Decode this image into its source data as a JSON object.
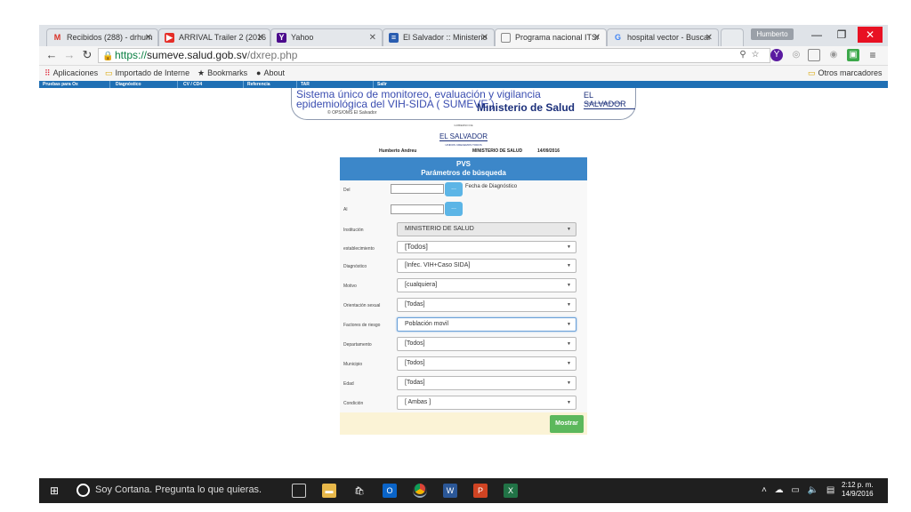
{
  "browser": {
    "tabs": [
      {
        "title": "Recibidos (288) - drhum",
        "favicon": "gmail-icon",
        "favicon_text": "M",
        "favicon_color": "#d93025"
      },
      {
        "title": "ARRIVAL Trailer 2 (2016",
        "favicon": "youtube-icon",
        "favicon_text": "▶",
        "favicon_color": "#e52d27"
      },
      {
        "title": "Yahoo",
        "favicon": "yahoo-icon",
        "favicon_text": "Y",
        "favicon_color": "#4b0a8c"
      },
      {
        "title": "El Salvador :: Ministerio",
        "favicon": "flag-icon",
        "favicon_text": "≡",
        "favicon_color": "#2a5db0"
      },
      {
        "title": "Programa nacional ITS/",
        "favicon": "page-icon",
        "favicon_text": "▯",
        "favicon_color": "#888888"
      },
      {
        "title": "hospital vector - Buscar",
        "favicon": "google-icon",
        "favicon_text": "G",
        "favicon_color": "#4285f4"
      }
    ],
    "profile_name": "Humberto",
    "url_scheme": "https://",
    "url_host": "sumeve.salud.gob.sv",
    "url_path": "/dxrep.php",
    "bookmarks": {
      "apps": "Aplicaciones",
      "imported": "Importado de Interne",
      "bookmarks": "Bookmarks",
      "about": "About",
      "other": "Otros marcadores"
    },
    "window_controls": {
      "minimize": "—",
      "maximize": "❐",
      "close": "✕"
    }
  },
  "page": {
    "menu": [
      "Pruebas para Ox",
      "Diagnóstico",
      "CV / CD4",
      "Referencia",
      "TAR",
      "Salir"
    ],
    "banner": {
      "line1": "Sistema único de monitoreo, evaluación y vigilancia",
      "line2": "epidemiológica del VIH-SIDA ( SUMEVE )",
      "credit": "© OPS/OMS El Salvador",
      "ministry": "Ministerio de Salud",
      "country": "EL SALVADOR",
      "country_sub": "UNIDOS CRECEMOS TODOS"
    },
    "logo": {
      "top": "GOBIERNO DE",
      "main": "EL SALVADOR",
      "sub": "UNIDOS CRECEMOS TODOS"
    },
    "user": {
      "name": "Humberto Andreu",
      "institution": "MINISTERIO DE SALUD",
      "date": "14/09/2016"
    },
    "panel": {
      "title": "PVS",
      "subtitle": "Parámetros de búsqueda",
      "del_label": "Del",
      "al_label": "Al",
      "date_button": "...",
      "fecha_label": "Fecha de Diagnóstico",
      "fields": [
        {
          "label": "Institución",
          "value": "MINISTERIO DE SALUD"
        },
        {
          "label": "establecimiento",
          "value": "[Todos]"
        },
        {
          "label": "Diagnóstico",
          "value": "[Infec. VIH+Caso SIDA]"
        },
        {
          "label": "Motivo",
          "value": "[cualquiera]"
        },
        {
          "label": "Orientación sexual",
          "value": "[Todas]"
        },
        {
          "label": "Factores de riesgo",
          "value": "Población movil"
        },
        {
          "label": "Departamento",
          "value": "[Todos]"
        },
        {
          "label": "Municipio",
          "value": "[Todos]"
        },
        {
          "label": "Edad",
          "value": "[Todas]"
        },
        {
          "label": "Condición",
          "value": "[ Ambas ]"
        }
      ],
      "submit": "Mostrar"
    }
  },
  "taskbar": {
    "cortana": "Soy Cortana. Pregunta lo que quieras.",
    "time": "2:12 p. m.",
    "date": "14/9/2016"
  }
}
